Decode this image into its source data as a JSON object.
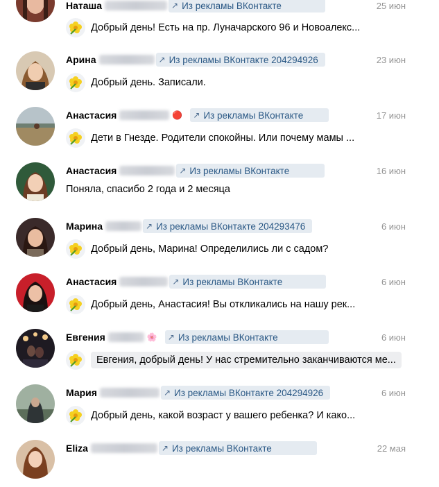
{
  "badge_text": "Из рекламы ВКонтакте",
  "conversations": [
    {
      "name": "Наташа",
      "ad": "Из рекламы ВКонтакте",
      "date": "25 июн",
      "message": "Добрый день! Есть на пр. Луначарского 96 и Новоалекс..."
    },
    {
      "name": "Арина",
      "ad": "Из рекламы ВКонтакте 204294926",
      "date": "23 июн",
      "message": "Добрый день. Записали."
    },
    {
      "name": "Анастасия",
      "ad": "Из рекламы ВКонтакте",
      "date": "17 июн",
      "message": "Дети в Гнезде. Родители спокойны. Или почему мамы ..."
    },
    {
      "name": "Анастасия",
      "ad": "Из рекламы ВКонтакте",
      "date": "16 июн",
      "message": "Поняла, спасибо 2 года и 2 месяца"
    },
    {
      "name": "Марина",
      "ad": "Из рекламы ВКонтакте 204293476",
      "date": "6 июн",
      "message": "Добрый день, Марина! Определились ли с садом?"
    },
    {
      "name": "Анастасия",
      "ad": "Из рекламы ВКонтакте",
      "date": "6 июн",
      "message": "Добрый день, Анастасия! Вы откликались на нашу рек..."
    },
    {
      "name": "Евгения",
      "ad": "Из рекламы ВКонтакте",
      "date": "6 июн",
      "message": "Евгения, добрый день! У нас стремительно заканчиваются ме..."
    },
    {
      "name": "Мария",
      "ad": "Из рекламы ВКонтакте 204294926",
      "date": "6 июн",
      "message": "Добрый день, какой возраст у вашего ребенка? И како..."
    },
    {
      "name": "Eliza",
      "ad": "Из рекламы ВКонтакте",
      "date": "22 мая",
      "message": ""
    }
  ]
}
